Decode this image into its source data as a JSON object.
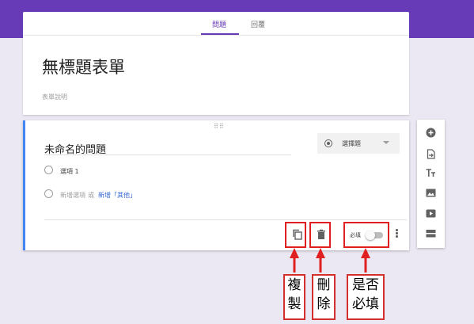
{
  "header": {
    "tabs": [
      {
        "label": "問題",
        "active": true
      },
      {
        "label": "回覆",
        "active": false
      }
    ]
  },
  "form": {
    "title": "無標題表單",
    "description_placeholder": "表單說明"
  },
  "question": {
    "title": "未命名的問題",
    "type_label": "選擇題",
    "options": [
      {
        "label": "選項 1"
      }
    ],
    "add_option": "新增選項",
    "add_or": "或",
    "add_other": "新增「其他」",
    "required_label": "必填",
    "required_on": false
  },
  "side_toolbar": {
    "icons": [
      "add-question-icon",
      "import-questions-icon",
      "add-title-icon",
      "add-image-icon",
      "add-video-icon",
      "add-section-icon"
    ]
  },
  "annotations": {
    "copy": [
      "複",
      "製"
    ],
    "delete": [
      "刪",
      "除"
    ],
    "required": [
      "是否",
      "必填"
    ]
  },
  "colors": {
    "purple": "#673ab7",
    "accent_blue": "#4285f4",
    "annotation_red": "#e02020"
  }
}
